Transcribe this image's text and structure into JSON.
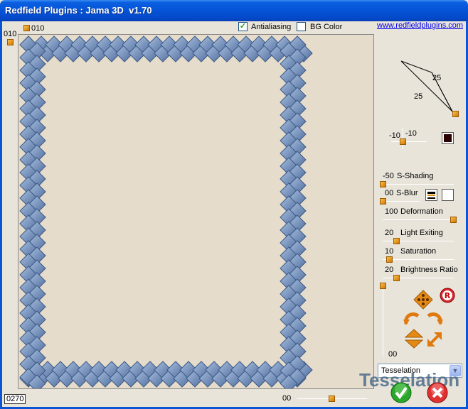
{
  "window": {
    "title": "Redfield Plugins : Jama 3D  v1.70"
  },
  "top": {
    "top_value": "010",
    "left_value": "010",
    "antialiasing": {
      "label": "Antialiasing",
      "checked": true
    },
    "bg_color": {
      "label": "BG Color",
      "checked": false
    },
    "link": "www.redfieldplugins.com"
  },
  "geometry": {
    "side_a": "25",
    "side_b": "25"
  },
  "light": {
    "x": "-10",
    "y": "-10",
    "color": "#2A0000"
  },
  "sliders": [
    {
      "value": "-50",
      "label": "S-Shading"
    },
    {
      "value": "00",
      "label": "S-Blur"
    },
    {
      "value": "100",
      "label": "Deformation"
    },
    {
      "value": "20",
      "label": "Light Exiting"
    },
    {
      "value": "10",
      "label": "Saturation"
    },
    {
      "value": "20",
      "label": "Brightness Ratio"
    }
  ],
  "vertical_slider_value": "00",
  "bottom": {
    "left_value": "0270",
    "right_value": "00"
  },
  "mode": {
    "selected": "Tesselation",
    "overlay_label": "Tesselation"
  },
  "colors": {
    "tile_dark": "#4D6C9C",
    "tile_light": "#A9BFDF",
    "preview_bg": "#E6DCCC",
    "orange": "#E08A10"
  }
}
